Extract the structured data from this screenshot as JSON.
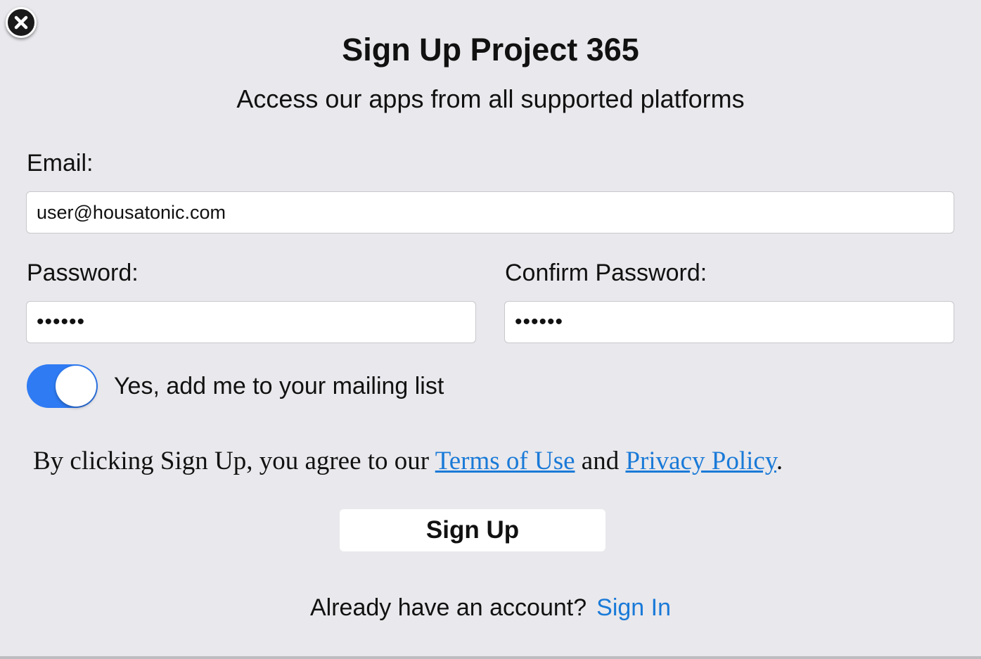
{
  "dialog": {
    "title": "Sign Up Project 365",
    "subtitle": "Access our apps from all supported platforms",
    "close_icon": "close-icon"
  },
  "form": {
    "email_label": "Email:",
    "email_value": "user@housatonic.com",
    "password_label": "Password:",
    "password_value": "••••••",
    "confirm_label": "Confirm Password:",
    "confirm_value": "••••••",
    "mailing_list_label": "Yes, add me to your mailing list",
    "mailing_list_on": true
  },
  "terms": {
    "prefix": "By clicking Sign Up, you agree to our ",
    "terms_link": "Terms of Use",
    "middle": " and ",
    "privacy_link": "Privacy Policy",
    "suffix": "."
  },
  "actions": {
    "signup_label": "Sign Up",
    "signin_prompt": "Already have an account?",
    "signin_link": "Sign In"
  },
  "colors": {
    "background": "#e9e8ec",
    "accent": "#2f7bf3",
    "link": "#1a7ad8"
  }
}
